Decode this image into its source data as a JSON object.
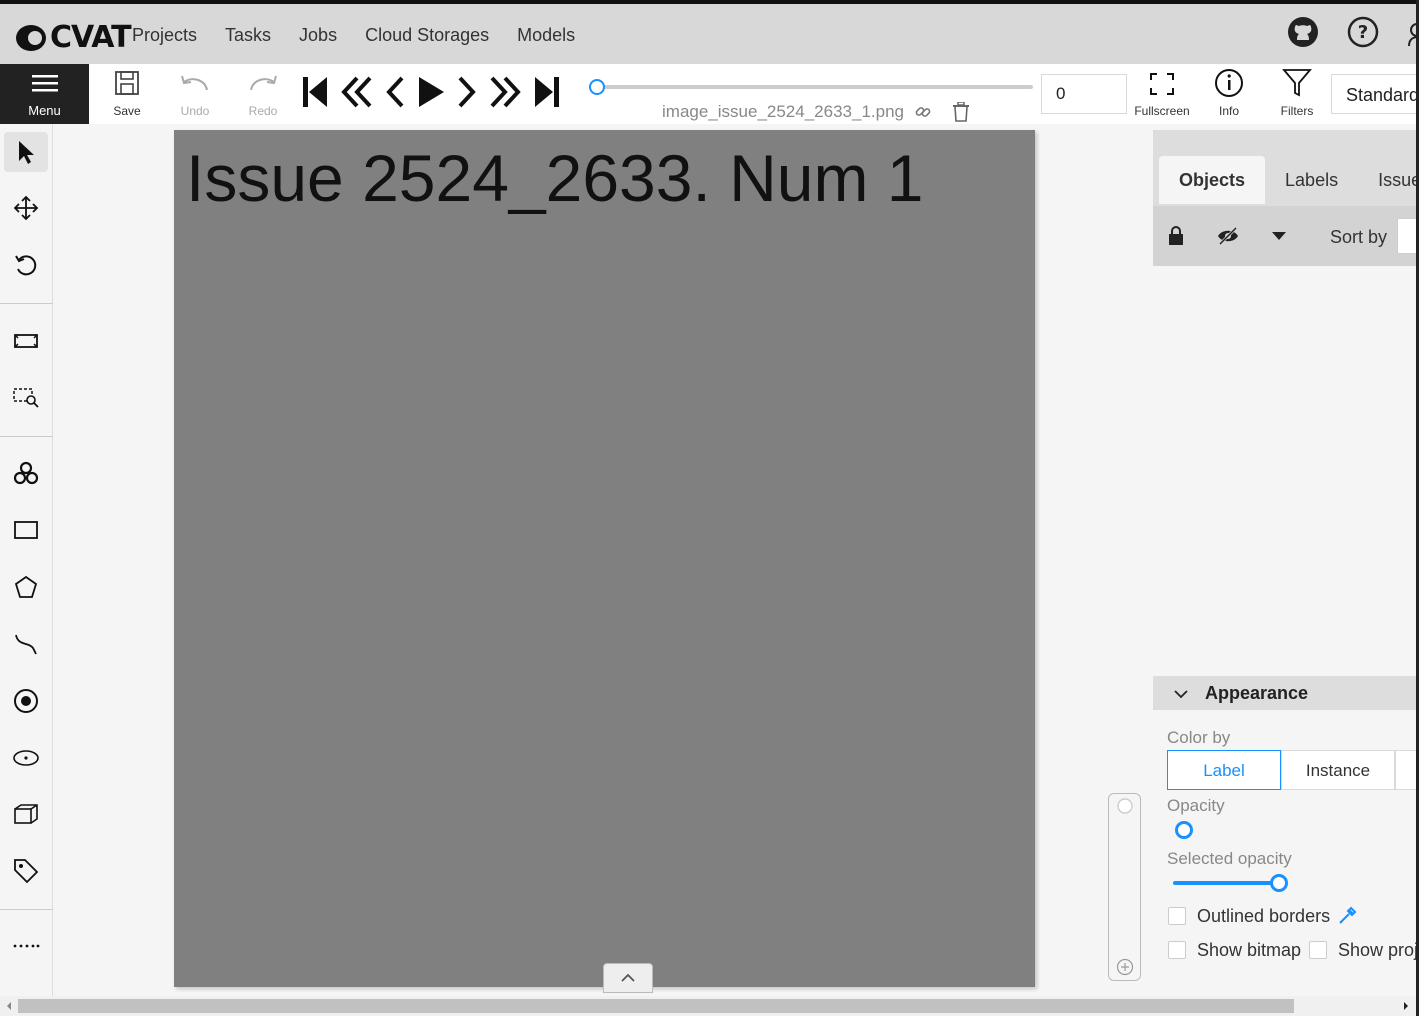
{
  "app": {
    "logo_text": "CVAT"
  },
  "nav": {
    "items": [
      "Projects",
      "Tasks",
      "Jobs",
      "Cloud Storages",
      "Models"
    ]
  },
  "toolbar": {
    "menu_label": "Menu",
    "save_label": "Save",
    "undo_label": "Undo",
    "redo_label": "Redo",
    "fullscreen_label": "Fullscreen",
    "info_label": "Info",
    "filters_label": "Filters",
    "frame_number": "0",
    "filename": "image_issue_2524_2633_1.png",
    "workspace": "Standard",
    "frame_progress": 0
  },
  "canvas": {
    "image_text": "Issue 2524_2633. Num 1"
  },
  "right_panel": {
    "tabs": [
      "Objects",
      "Labels",
      "Issues"
    ],
    "sort_by_label": "Sort by"
  },
  "appearance": {
    "title": "Appearance",
    "color_by_label": "Color by",
    "color_by_options": [
      "Label",
      "Instance"
    ],
    "color_by_selected": "Label",
    "opacity_label": "Opacity",
    "opacity_value": 0,
    "selected_opacity_label": "Selected opacity",
    "selected_opacity_value": 0.4,
    "outlined_borders_label": "Outlined borders",
    "show_bitmap_label": "Show bitmap",
    "show_projections_label": "Show projections"
  },
  "colors": {
    "accent": "#1890ff",
    "menu_bg": "#222222",
    "image_bg": "#808080"
  }
}
